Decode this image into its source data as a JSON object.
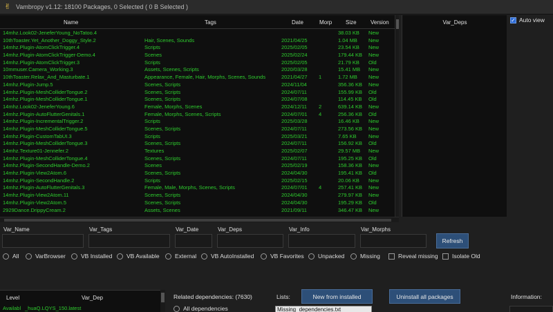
{
  "window": {
    "icon": "peace-hand-icon",
    "title": "Vambropy v1.12: 18100 Packages, 0 Selected ( 0 B Selected )"
  },
  "grid": {
    "columns": [
      "Name",
      "Tags",
      "Date",
      "Morp",
      "Size",
      "Version"
    ],
    "rows": [
      {
        "name": "14mhz.Look02-JeneferYoung_NoTatoo.4",
        "tags": "",
        "date": "",
        "morphs": "",
        "size": "38.03 KB",
        "version": "New"
      },
      {
        "name": "10thToaster.Yet_Another_Doggy_Style.2",
        "tags": "Hair, Scenes, Sounds",
        "date": "2021/04/25",
        "morphs": "",
        "size": "1.04 MB",
        "version": "New"
      },
      {
        "name": "14mhz.Plugin-AtomClickTrigger.4",
        "tags": "Scripts",
        "date": "2025/02/05",
        "morphs": "",
        "size": "23.54 KB",
        "version": "New"
      },
      {
        "name": "14mhz.Plugin-AtomClickTrigger-Demo.4",
        "tags": "Scenes",
        "date": "2025/02/24",
        "morphs": "",
        "size": "179.44 KB",
        "version": "New"
      },
      {
        "name": "14mhz.Plugin-AtomClickTrigger.3",
        "tags": "Scripts",
        "date": "2025/02/05",
        "morphs": "",
        "size": "21.79 KB",
        "version": "Old"
      },
      {
        "name": "10mmuser.Camera_Working.3",
        "tags": "Assets, Scenes, Scripts",
        "date": "2020/03/28",
        "morphs": "",
        "size": "15.41 MB",
        "version": "New"
      },
      {
        "name": "10thToaster.Relax_And_Masturbate.1",
        "tags": "Appearance, Female, Hair, Morphs, Scenes, Sounds",
        "date": "2021/04/27",
        "morphs": "1",
        "size": "1.72 MB",
        "version": "New"
      },
      {
        "name": "14mhz.Plugin-Jump.5",
        "tags": "Scenes, Scripts",
        "date": "2024/11/04",
        "morphs": "",
        "size": "356.36 KB",
        "version": "New"
      },
      {
        "name": "14mhz.Plugin-MeshColliderTongue.2",
        "tags": "Scenes, Scripts",
        "date": "2024/07/11",
        "morphs": "",
        "size": "155.99 KB",
        "version": "Old"
      },
      {
        "name": "14mhz.Plugin-MeshColliderTongue.1",
        "tags": "Scenes, Scripts",
        "date": "2024/07/08",
        "morphs": "",
        "size": "114.45 KB",
        "version": "Old"
      },
      {
        "name": "14mhz.Look02-JeneferYoung.6",
        "tags": "Female, Morphs, Scenes",
        "date": "2024/12/11",
        "morphs": "2",
        "size": "639.14 KB",
        "version": "New"
      },
      {
        "name": "14mhz.Plugin-AutoFlutterGenitals.1",
        "tags": "Female, Morphs, Scenes, Scripts",
        "date": "2024/07/01",
        "morphs": "4",
        "size": "256.36 KB",
        "version": "Old"
      },
      {
        "name": "14mhz.Plugin-IncrementalTrigger.2",
        "tags": "Scripts",
        "date": "2025/03/28",
        "morphs": "",
        "size": "16.46 KB",
        "version": "New"
      },
      {
        "name": "14mhz.Plugin-MeshColliderTongue.5",
        "tags": "Scenes, Scripts",
        "date": "2024/07/11",
        "morphs": "",
        "size": "273.56 KB",
        "version": "New"
      },
      {
        "name": "14mhz.Plugin-CustomTabUI.3",
        "tags": "Scripts",
        "date": "2025/03/21",
        "morphs": "",
        "size": "7.65 KB",
        "version": "New"
      },
      {
        "name": "14mhz.Plugin-MeshColliderTongue.3",
        "tags": "Scenes, Scripts",
        "date": "2024/07/11",
        "morphs": "",
        "size": "156.92 KB",
        "version": "Old"
      },
      {
        "name": "14mhz.Texture01-Jennefer.2",
        "tags": "Textures",
        "date": "2025/02/07",
        "morphs": "",
        "size": "29.57 MB",
        "version": "New"
      },
      {
        "name": "14mhz.Plugin-MeshColliderTongue.4",
        "tags": "Scenes, Scripts",
        "date": "2024/07/11",
        "morphs": "",
        "size": "195.25 KB",
        "version": "Old"
      },
      {
        "name": "14mhz.Plugin-SecondHandle-Demo.2",
        "tags": "Scenes",
        "date": "2025/02/19",
        "morphs": "",
        "size": "158.36 KB",
        "version": "New"
      },
      {
        "name": "14mhz.Plugin-View2Atom.6",
        "tags": "Scenes, Scripts",
        "date": "2024/04/30",
        "morphs": "",
        "size": "195.41 KB",
        "version": "Old"
      },
      {
        "name": "14mhz.Plugin-SecondHandle.2",
        "tags": "Scripts",
        "date": "2025/02/15",
        "morphs": "",
        "size": "20.06 KB",
        "version": "New"
      },
      {
        "name": "14mhz.Plugin-AutoFlutterGenitals.3",
        "tags": "Female, Male, Morphs, Scenes, Scripts",
        "date": "2024/07/01",
        "morphs": "4",
        "size": "257.41 KB",
        "version": "New"
      },
      {
        "name": "14mhz.Plugin-View2Atom.11",
        "tags": "Scenes, Scripts",
        "date": "2024/04/30",
        "morphs": "",
        "size": "279.97 KB",
        "version": "New"
      },
      {
        "name": "14mhz.Plugin-View2Atom.5",
        "tags": "Scenes, Scripts",
        "date": "2024/04/30",
        "morphs": "",
        "size": "195.29 KB",
        "version": "Old"
      },
      {
        "name": "2929Dance.DrippyCream.2",
        "tags": "Assets, Scenes",
        "date": "2021/09/11",
        "morphs": "",
        "size": "346.47 KB",
        "version": "New"
      }
    ]
  },
  "deps_panel": {
    "header": "Var_Deps",
    "auto_view_label": "Auto view",
    "auto_view_checked": true
  },
  "filters": {
    "labels": [
      "Var_Name",
      "Var_Tags",
      "Var_Date",
      "Var_Deps",
      "Var_Info",
      "Var_Morphs"
    ],
    "values": [
      "",
      "",
      "",
      "",
      "",
      ""
    ],
    "refresh_label": "Refresh"
  },
  "options": {
    "radios": [
      "All",
      "VarBrowser",
      "VB Installed",
      "VB Available",
      "External",
      "VB AutoInstalled",
      "VB Favorites",
      "Unpacked",
      "Missing"
    ],
    "checkboxes": [
      "Reveal missing",
      "Isolate Old"
    ]
  },
  "bottom": {
    "dep_columns": [
      "Level",
      "Var_Dep"
    ],
    "dep_first_row": {
      "level": "Availabl",
      "dep": "_huaQ.LQYS_150.latest"
    },
    "related_label": "Related dependencies: (7630)",
    "all_dependencies_label": "All dependencies",
    "lists_label": "Lists:",
    "new_from_installed_label": "New from installed",
    "uninstall_all_label": "Uninstall all packages",
    "lists_selected": "Missing_dependencies.txt",
    "information_label": "Information:"
  },
  "colors": {
    "row_text": "#2ecc2e",
    "button_bg": "#2d4f78",
    "checkbox_accent": "#2e6bd6"
  }
}
